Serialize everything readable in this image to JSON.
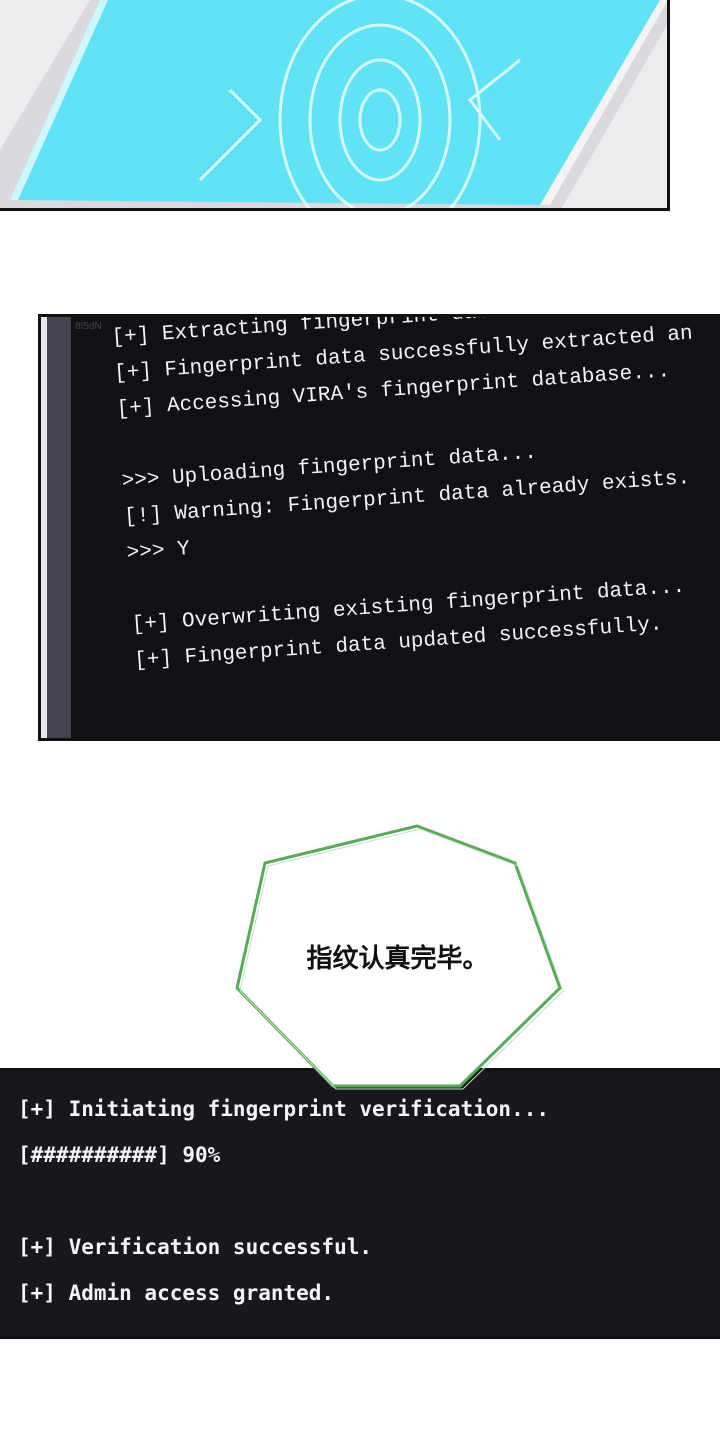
{
  "panel_top": {
    "image": "fingerprint-phone-screen",
    "screen_color": "#5fe3f5"
  },
  "panel_terminal_1": {
    "watermark": "8I5dN",
    "lines": [
      "[+] Extracting fingerprint data from the imag",
      "[+] Fingerprint data successfully extracted an",
      "[+] Accessing VIRA's fingerprint database...",
      "",
      ">>> Uploading fingerprint data...",
      "[!] Warning: Fingerprint data already exists.",
      ">>> Y",
      "",
      "[+] Overwriting existing fingerprint data...",
      "[+] Fingerprint data updated successfully."
    ]
  },
  "speech_bubble": {
    "text": "指纹认真完毕。",
    "outline_color": "#5aa95a"
  },
  "panel_terminal_2": {
    "lines": [
      "[+] Initiating fingerprint verification...",
      "[##########] 90%",
      "",
      "[+] Verification successful.",
      "[+] Admin access granted."
    ],
    "progress_percent": 90
  }
}
